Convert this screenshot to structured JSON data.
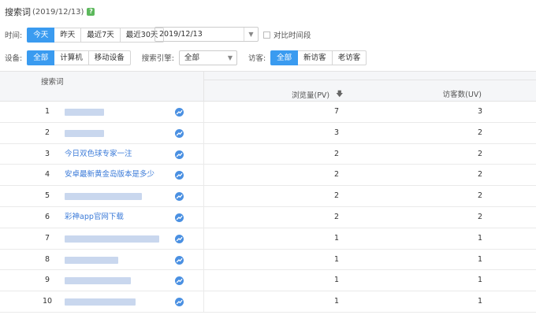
{
  "header": {
    "title": "搜索词",
    "date": "(2019/12/13)",
    "help_icon": "question-icon"
  },
  "time_filter": {
    "label": "时间:",
    "options": [
      "今天",
      "昨天",
      "最近7天",
      "最近30天"
    ],
    "date_value": "2019/12/13",
    "compare_label": "对比时间段"
  },
  "device_filter": {
    "label": "设备:",
    "options": [
      "全部",
      "计算机",
      "移动设备"
    ]
  },
  "engine_filter": {
    "label": "搜索引擎:",
    "value": "全部"
  },
  "visitor_filter": {
    "label": "访客:",
    "options": [
      "全部",
      "新访客",
      "老访客"
    ]
  },
  "colors": {
    "accent": "#3a9bf0",
    "link": "#3a7ad8",
    "header_bg": "#f5f6f8"
  },
  "table": {
    "columns": {
      "keyword": "搜索词",
      "pv": "浏览量(PV)",
      "uv": "访客数(UV)"
    },
    "rows": [
      {
        "idx": "1",
        "keyword": "",
        "pv": "7",
        "uv": "3"
      },
      {
        "idx": "2",
        "keyword": "",
        "pv": "3",
        "uv": "2"
      },
      {
        "idx": "3",
        "keyword": "今日双色球专家一注",
        "pv": "2",
        "uv": "2"
      },
      {
        "idx": "4",
        "keyword": "安卓最新黄金岛版本是多少",
        "pv": "2",
        "uv": "2"
      },
      {
        "idx": "5",
        "keyword": "",
        "pv": "2",
        "uv": "2"
      },
      {
        "idx": "6",
        "keyword": "彩神app官网下载",
        "pv": "2",
        "uv": "2"
      },
      {
        "idx": "7",
        "keyword": "",
        "pv": "1",
        "uv": "1"
      },
      {
        "idx": "8",
        "keyword": "",
        "pv": "1",
        "uv": "1"
      },
      {
        "idx": "9",
        "keyword": "",
        "pv": "1",
        "uv": "1"
      },
      {
        "idx": "10",
        "keyword": "",
        "pv": "1",
        "uv": "1"
      }
    ]
  }
}
